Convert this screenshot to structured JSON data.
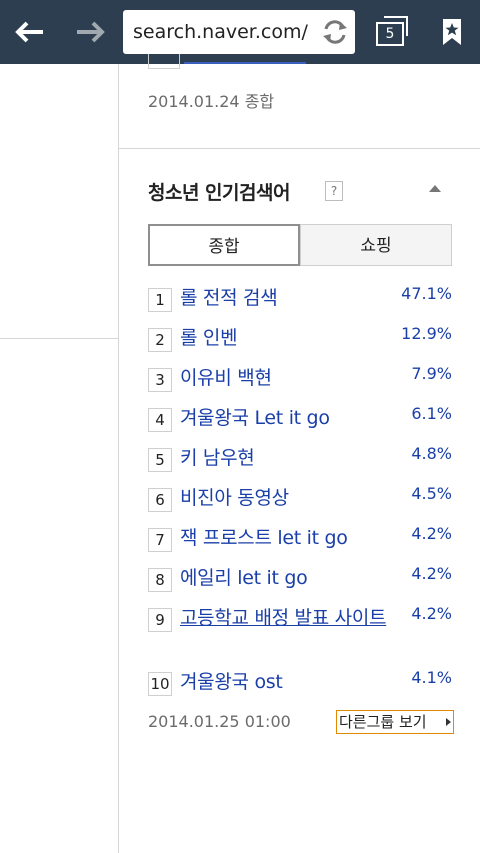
{
  "browser": {
    "url": "search.naver.com/",
    "tab_count": "5"
  },
  "previous": {
    "date": "2014.01.24 종합"
  },
  "section": {
    "title": "청소년 인기검색어",
    "help": "?"
  },
  "tabs": [
    {
      "label": "종합"
    },
    {
      "label": "쇼핑"
    }
  ],
  "rankings": [
    {
      "rank": "1",
      "term": "롤 전적 검색",
      "percent": "47.1%"
    },
    {
      "rank": "2",
      "term": "롤 인벤",
      "percent": "12.9%"
    },
    {
      "rank": "3",
      "term": "이유비 백현",
      "percent": "7.9%"
    },
    {
      "rank": "4",
      "term": "겨울왕국 Let it go",
      "percent": "6.1%"
    },
    {
      "rank": "5",
      "term": "키 남우현",
      "percent": "4.8%"
    },
    {
      "rank": "6",
      "term": "비진아 동영상",
      "percent": "4.5%"
    },
    {
      "rank": "7",
      "term": "잭 프로스트 let it go",
      "percent": "4.2%"
    },
    {
      "rank": "8",
      "term": "에일리 let it go",
      "percent": "4.2%"
    },
    {
      "rank": "9",
      "term": "고등학교 배정 발표 사이트",
      "percent": "4.2%"
    },
    {
      "rank": "10",
      "term": "겨울왕국 ost",
      "percent": "4.1%"
    }
  ],
  "footer": {
    "date": "2014.01.25 01:00",
    "other_group_label": "다른그룹 보기"
  },
  "colors": {
    "toolbar": "#2c3e50",
    "link": "#1a3fa8",
    "accent_border": "#e08a00"
  }
}
